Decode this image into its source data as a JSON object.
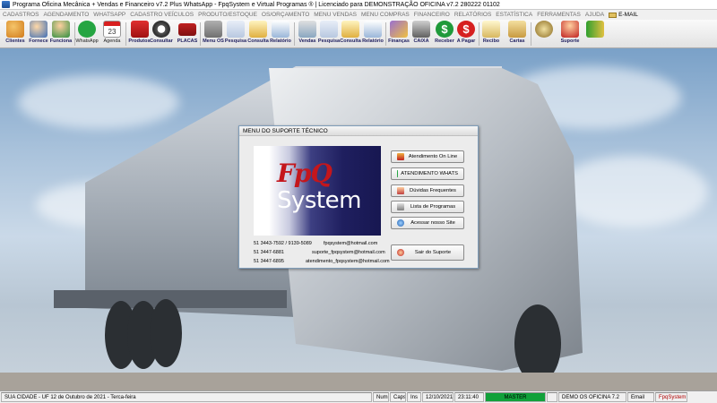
{
  "window": {
    "title": "Programa Oficina Mecânica + Vendas e Financeiro v7.2 Plus WhatsApp - FpqSystem e Virtual Programas ® | Licenciado para  DEMONSTRAÇÃO OFICINA v7.2 280222 01102"
  },
  "menu": {
    "items": [
      "CADASTROS",
      "AGENDAMENTO",
      "WHATSAPP",
      "CADASTRO VEÍCULOS",
      "PRODUTO/ESTOQUE",
      "OS/ORÇAMENTO",
      "MENU VENDAS",
      "MENU COMPRAS",
      "FINANCEIRO",
      "RELATÓRIOS",
      "ESTATÍSTICA",
      "FERRAMENTAS",
      "AJUDA"
    ],
    "email": "E-MAIL"
  },
  "toolbar": {
    "clientes": "Clientes",
    "fornece": "Fornece",
    "funciona": "Funciona",
    "whatsapp": "WhatsApp",
    "agenda": "Agenda",
    "produtos": "Produtos",
    "consultar": "Consultar",
    "placas": "PLACAS",
    "menu_os": "Menu OS",
    "pesquisa1": "Pesquisa",
    "consulta1": "Consulta",
    "relatorio1": "Relatório",
    "vendas": "Vendas",
    "pesquisa2": "Pesquisa",
    "consulta2": "Consulta",
    "relatorio2": "Relatório",
    "financas": "Finanças",
    "caixa": "CAIXA",
    "receber": "Receber",
    "a_pagar": "A Pagar",
    "recibo": "Recibo",
    "cartas": "Cartas",
    "suporte": "Suporte",
    "agenda_day": "23"
  },
  "dialog": {
    "title": "MENU DO SUPORTE TÉCNICO",
    "logo_fpq": "FpQ",
    "logo_system": "System",
    "buttons": {
      "atendimento_online": "Atendimento On Line",
      "atendimento_whats": "ATENDIMENTO WHATS",
      "duvidas": "Dúvidas Frequentes",
      "lista_programas": "Lista de Programas",
      "acessar_site": "Acessar nosso Site",
      "sair": "Sair do Suporte"
    },
    "contacts": {
      "phone1": "51 3443-7592 / 9139-5089",
      "email1": "fpqsystem@hotmail.com",
      "phone2": "51 3447-6881",
      "email2": "suporte_fpqsystem@hotmail.com",
      "phone3": "51 3447-6895",
      "email3": "atendimento_fpqsystem@hotmail.com"
    }
  },
  "status": {
    "city": "SUA CIDADE - UF 12 de Outubro de 2021 - Terca-feira",
    "num": "Num",
    "caps": "Caps",
    "ins": "Ins",
    "date": "12/10/2021",
    "time": "23:11:40",
    "master": "MASTER",
    "company": "DEMO OS OFICINA 7.2",
    "email": "Email",
    "brand": "FpqSystem"
  },
  "colors": {
    "toolbar_label": "#202060",
    "logo_red": "#c4161c",
    "logo_navy": "#1f1f5f",
    "status_master": "#11a13a"
  }
}
